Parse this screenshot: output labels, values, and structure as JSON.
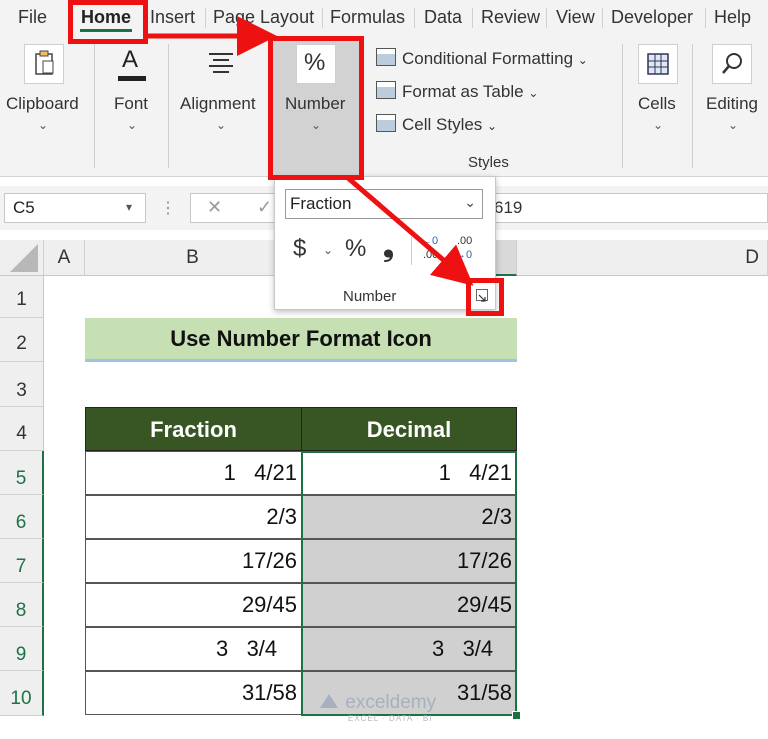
{
  "menu": {
    "tabs": [
      "File",
      "Home",
      "Insert",
      "Page Layout",
      "Formulas",
      "Data",
      "Review",
      "View",
      "Developer",
      "Help"
    ],
    "active": "Home"
  },
  "ribbon": {
    "groups": {
      "clipboard": "Clipboard",
      "font": "Font",
      "alignment": "Alignment",
      "number": "Number",
      "cells": "Cells",
      "editing": "Editing",
      "styles": "Styles"
    },
    "styles_items": [
      "Conditional Formatting",
      "Format as Table",
      "Cell Styles"
    ],
    "number_glyph": "%",
    "font_glyph": "A"
  },
  "formula_bar": {
    "name_box": "C5",
    "formula_tail": "619"
  },
  "number_popup": {
    "format_value": "Fraction",
    "currency": "$",
    "percent": "%",
    "comma": "❟",
    "inc_decimal_top": "←0",
    "inc_decimal_bottom": ".00",
    "dec_decimal_top": ".00",
    "dec_decimal_bottom": "→0",
    "group_label": "Number"
  },
  "grid": {
    "columns": [
      "A",
      "B",
      "D"
    ],
    "rows": [
      "1",
      "2",
      "3",
      "4",
      "5",
      "6",
      "7",
      "8",
      "9",
      "10"
    ],
    "title": "Use Number Format Icon",
    "headers": [
      "Fraction",
      "Decimal"
    ],
    "fraction": [
      "1   4/21",
      "2/3",
      "17/26",
      "29/45",
      "3   3/4",
      "31/58"
    ],
    "decimal": [
      "1   4/21",
      "2/3",
      "17/26",
      "29/45",
      "3   3/4",
      "31/58"
    ]
  },
  "watermark": {
    "name": "exceldemy",
    "tagline": "EXCEL · DATA · BI"
  },
  "colors": {
    "header_green": "#375623",
    "title_fill": "#c6e0b4",
    "highlight_red": "#ee1111",
    "selection_green": "#1e7145",
    "decimal_fill": "#d0d0d0"
  }
}
